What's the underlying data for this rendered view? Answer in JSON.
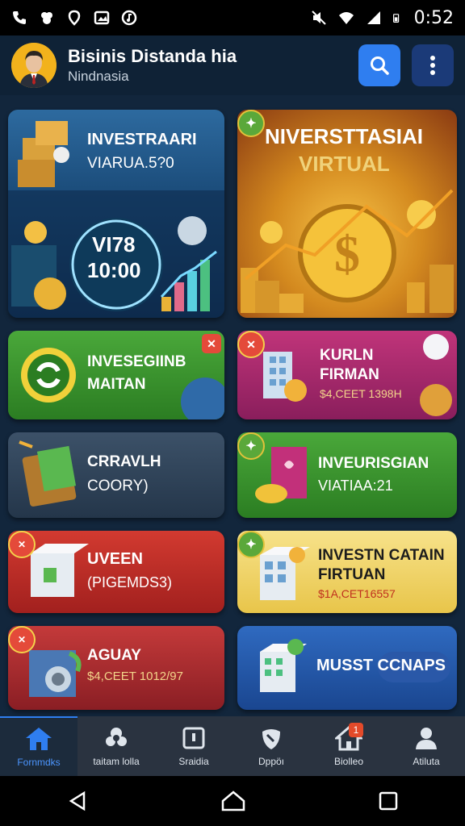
{
  "status_bar": {
    "time": "0:52"
  },
  "header": {
    "title": "Bisinis Distanda hia",
    "subtitle": "Nindnasia",
    "icons": [
      "search-icon",
      "more-vertical-icon"
    ]
  },
  "cards": [
    {
      "id": "investraari",
      "line1": "INVESTRAARI",
      "line2": "VIARUA.5?0",
      "center_line1": "VI78",
      "center_line2": "10:00"
    },
    {
      "id": "niverst",
      "line1": "NIVERSTTASIAI",
      "line2": "VIRTUAL"
    },
    {
      "id": "invesegiinb",
      "line1": "INVESEGIINB",
      "line2": "MAITAN"
    },
    {
      "id": "kurln",
      "line1": "KURLN",
      "line2": "FIRMAN",
      "line3": "$4,CEET 1398H"
    },
    {
      "id": "crravlh",
      "line1": "CRRAVLH",
      "line2": "COORY)"
    },
    {
      "id": "inveurisgian",
      "line1": "INVEURISGIAN",
      "line2": "VIATIAA:21"
    },
    {
      "id": "uveen",
      "line1": "UVEEN",
      "line2": "(PIGEMDS3)"
    },
    {
      "id": "investn",
      "line1": "INVESTN CATAIN",
      "line2": "FIRTUAN",
      "line3": "$1A,CET16557"
    },
    {
      "id": "aguay",
      "line1": "AGUAY",
      "line2": "$4,CEET 1012/97"
    },
    {
      "id": "musst",
      "line1": "MUSST CCNAPS"
    }
  ],
  "bottom_nav": [
    {
      "label": "Fornmdks",
      "icon": "home-icon",
      "active": true
    },
    {
      "label": "taitam lolla",
      "icon": "gear-cluster-icon",
      "active": false
    },
    {
      "label": "Sraidia",
      "icon": "id-badge-icon",
      "active": false
    },
    {
      "label": "Dppöı",
      "icon": "leaf-shield-icon",
      "active": false
    },
    {
      "label": "Biolleo",
      "icon": "house-notification-icon",
      "active": false,
      "badge": "1"
    },
    {
      "label": "Atiluta",
      "icon": "user-icon",
      "active": false
    }
  ],
  "system_nav": [
    "back-icon",
    "home-icon",
    "recents-icon"
  ]
}
